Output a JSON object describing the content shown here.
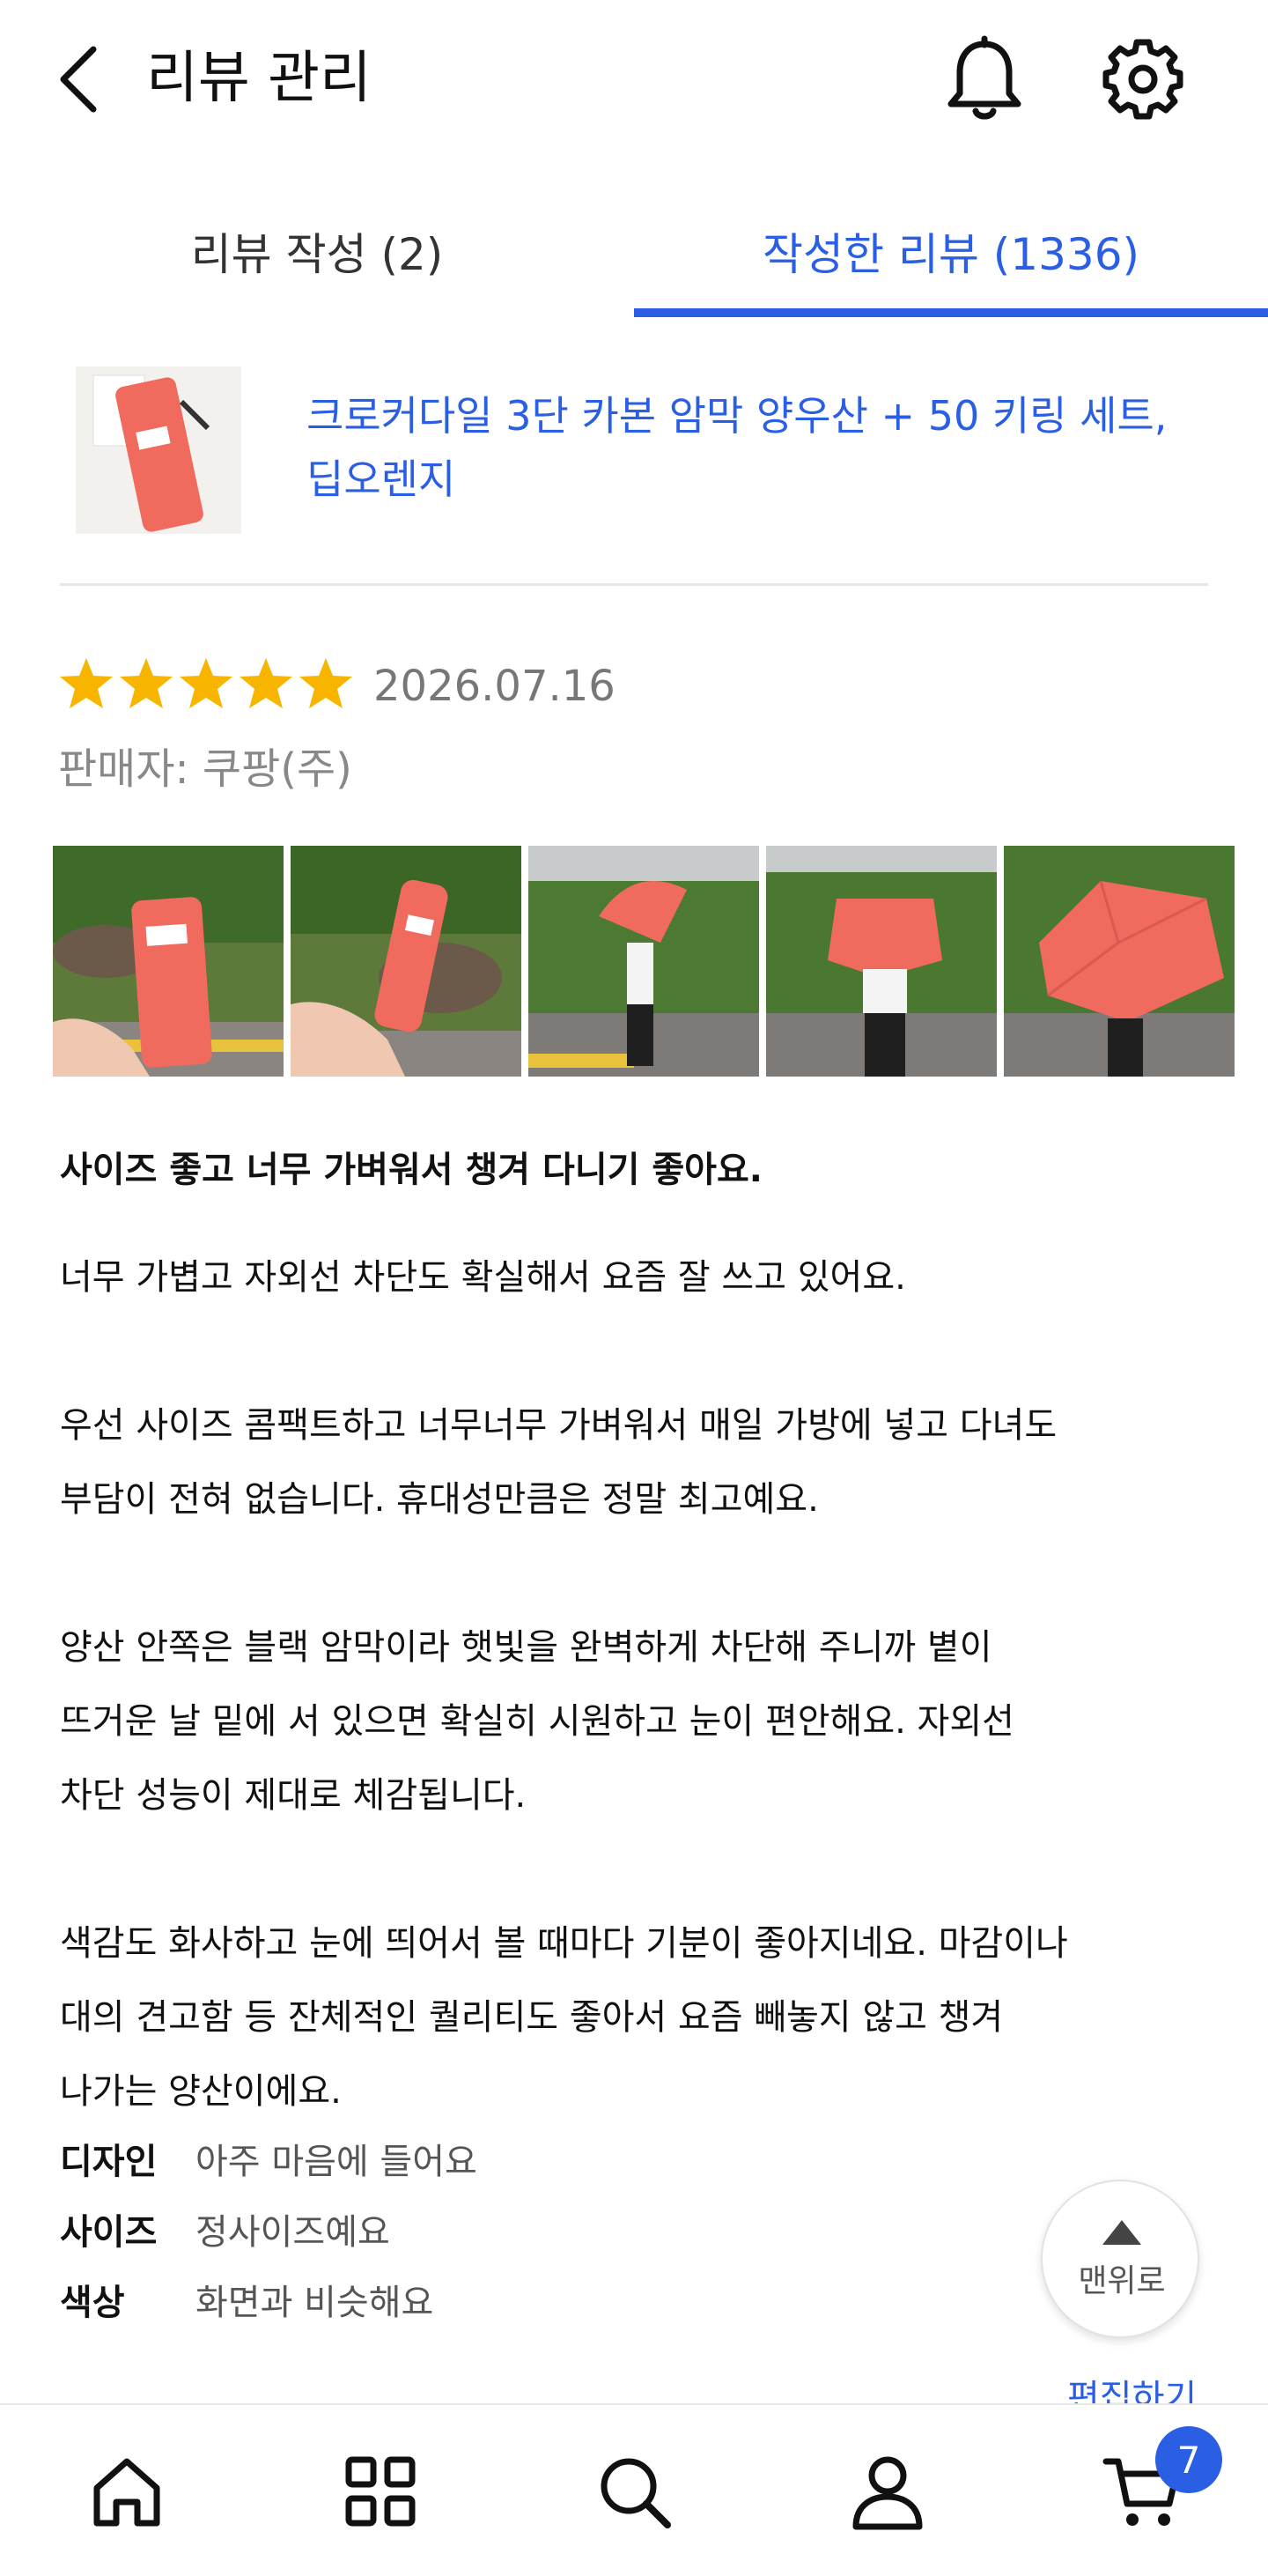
{
  "header": {
    "title": "리뷰 관리"
  },
  "tabs": [
    {
      "label": "리뷰 작성 (2)"
    },
    {
      "label": "작성한 리뷰 (1336)"
    }
  ],
  "product": {
    "name_line1": "크로커다일 3단 카본 암막 양우산 + 50 키링 세트,",
    "name_line2": "딥오렌지"
  },
  "review": {
    "rating": 5,
    "rating_max": 5,
    "date": "2026.07.16",
    "seller": "판매자: 쿠팡(주)",
    "photo_count": 5,
    "title": "사이즈 좋고 너무 가벼워서 챙겨 다니기 좋아요.",
    "paragraphs": [
      [
        "너무 가볍고 자외선 차단도 확실해서 요즘 잘 쓰고 있어요."
      ],
      [
        "우선 사이즈 콤팩트하고 너무너무 가벼워서 매일 가방에 넣고 다녀도",
        "부담이 전혀 없습니다. 휴대성만큼은 정말 최고예요."
      ],
      [
        "양산 안쪽은 블랙 암막이라 햇빛을 완벽하게 차단해 주니까 볕이",
        "뜨거운 날 밑에 서 있으면 확실히 시원하고 눈이 편안해요. 자외선",
        "차단 성능이 제대로 체감됩니다."
      ],
      [
        "색감도 화사하고 눈에 띄어서 볼 때마다 기분이 좋아지네요. 마감이나",
        "대의 견고함 등 잔체적인 퀄리티도 좋아서 요즘 빼놓지 않고 챙겨",
        "나가는 양산이에요."
      ]
    ],
    "attributes": [
      {
        "key": "디자인",
        "value": "아주 마음에 들어요"
      },
      {
        "key": "사이즈",
        "value": "정사이즈예요"
      },
      {
        "key": "색상",
        "value": "화면과 비슷해요"
      }
    ],
    "edit_label": "편집하기"
  },
  "scroll_top": {
    "label": "맨위로"
  },
  "bottom_nav": {
    "items": [
      "home-icon",
      "categories-icon",
      "search-icon",
      "account-icon",
      "cart-icon"
    ],
    "cart_count": "7"
  },
  "colors": {
    "accent": "#2a5fe3",
    "star": "#f7b500",
    "umbrella": "#f06a5e"
  }
}
